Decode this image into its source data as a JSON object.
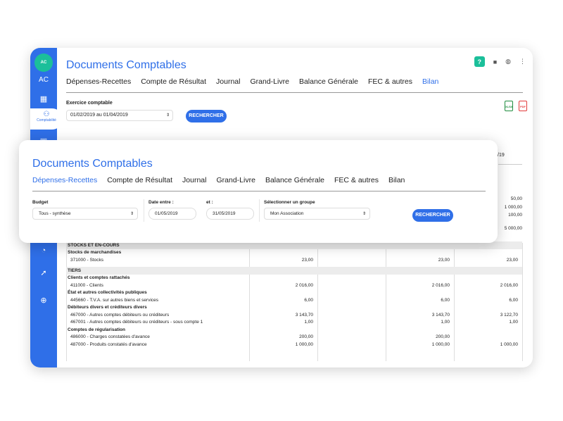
{
  "app": {
    "logo_text": "AC",
    "initials": "AC",
    "active_nav_label": "Comptabilité"
  },
  "back": {
    "title": "Documents Comptables",
    "tabs": [
      "Dépenses-Recettes",
      "Compte de Résultat",
      "Journal",
      "Grand-Livre",
      "Balance Générale",
      "FEC & autres",
      "Bilan"
    ],
    "exercice_label": "Exercice comptable",
    "exercice_value": "01/02/2019 au 01/04/2019",
    "search_label": "RECHERCHER",
    "export_xlsx": "XLSX",
    "export_pdf": "PDF",
    "period_fragment": "/19",
    "right_values": [
      "50,00",
      "1 000,00",
      "100,00",
      "5 000,00"
    ]
  },
  "table": {
    "rows": [
      {
        "kind": "sec",
        "label": "STOCKS ET EN-COURS",
        "v": [
          "",
          "",
          "",
          ""
        ]
      },
      {
        "kind": "sub",
        "label": "Stocks de marchandises",
        "v": [
          "",
          "",
          "",
          ""
        ]
      },
      {
        "kind": "acct",
        "label": "371000 - Stocks",
        "v": [
          "23,00",
          "",
          "23,00",
          "23,00"
        ]
      },
      {
        "kind": "gap",
        "label": "",
        "v": [
          "",
          "",
          "",
          ""
        ]
      },
      {
        "kind": "sec",
        "label": "TIERS",
        "v": [
          "",
          "",
          "",
          ""
        ]
      },
      {
        "kind": "sub",
        "label": "Clients et comptes rattachés",
        "v": [
          "",
          "",
          "",
          ""
        ]
      },
      {
        "kind": "acct",
        "label": "411000 - Clients",
        "v": [
          "2 016,00",
          "",
          "2 016,00",
          "2 016,00"
        ]
      },
      {
        "kind": "sub",
        "label": "État et autres collectivités publiques",
        "v": [
          "",
          "",
          "",
          ""
        ]
      },
      {
        "kind": "acct",
        "label": "445660 - T.V.A. sur autres biens et services",
        "v": [
          "6,00",
          "",
          "6,00",
          "6,00"
        ]
      },
      {
        "kind": "sub",
        "label": "Débiteurs divers et créditeurs divers",
        "v": [
          "",
          "",
          "",
          ""
        ]
      },
      {
        "kind": "acct",
        "label": "467000 - Autres comptes débiteurs ou créditeurs",
        "v": [
          "3 143,70",
          "",
          "3 143,70",
          "3 122,70"
        ]
      },
      {
        "kind": "acct",
        "label": "467001 - Autres comptes débiteurs ou créditeurs - sous compte 1",
        "v": [
          "1,00",
          "",
          "1,00",
          "1,00"
        ]
      },
      {
        "kind": "sub",
        "label": "Comptes de régularisation",
        "v": [
          "",
          "",
          "",
          ""
        ]
      },
      {
        "kind": "acct",
        "label": "486000 - Charges constatées d'avance",
        "v": [
          "200,00",
          "",
          "200,00",
          ""
        ]
      },
      {
        "kind": "acct",
        "label": "487000 - Produits constatés d'avance",
        "v": [
          "1 000,00",
          "",
          "1 000,00",
          "1 000,00"
        ]
      }
    ]
  },
  "front": {
    "title": "Documents Comptables",
    "tabs": [
      "Dépenses-Recettes",
      "Compte de Résultat",
      "Journal",
      "Grand-Livre",
      "Balance Générale",
      "FEC & autres",
      "Bilan"
    ],
    "budget_label": "Budget",
    "budget_value": "Tous - synthèse",
    "date_start_label": "Date entre :",
    "date_start_value": "01/05/2019",
    "date_end_label": "et :",
    "date_end_value": "31/05/2019",
    "group_label": "Sélectionner un groupe",
    "group_value": "Mon Association",
    "search_label": "RECHERCHER"
  },
  "colors": {
    "primary": "#2f6fe8",
    "accent": "#1bbf9a",
    "xlsx": "#1e8c3e",
    "pdf": "#e23a3a"
  }
}
